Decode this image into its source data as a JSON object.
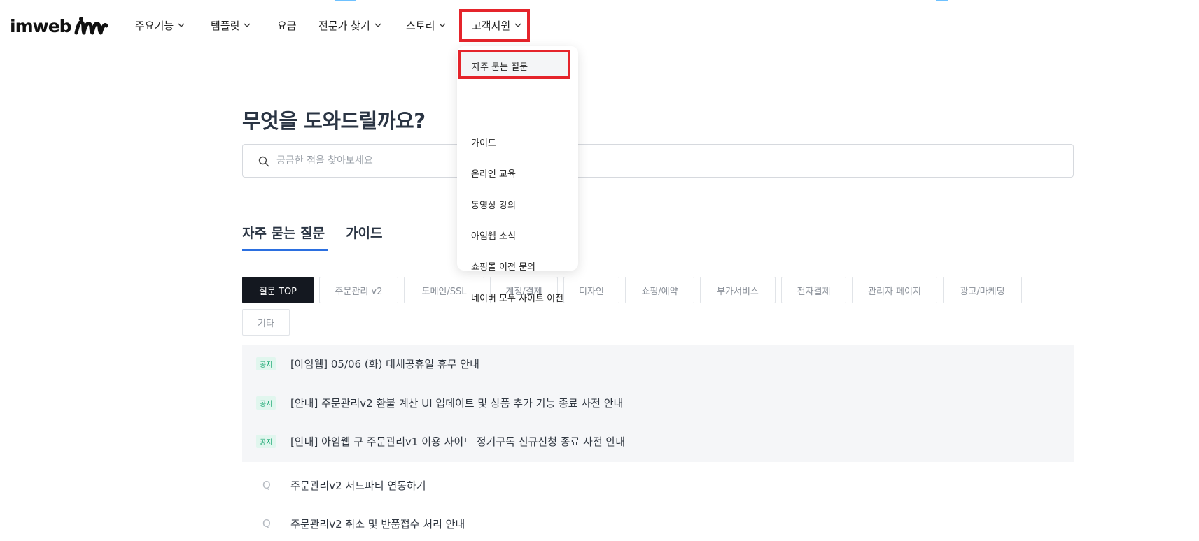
{
  "header": {
    "logo_text": "imweb",
    "nav": [
      {
        "label": "주요기능",
        "has_dropdown": true
      },
      {
        "label": "템플릿",
        "has_dropdown": true
      },
      {
        "label": "요금",
        "has_dropdown": false
      },
      {
        "label": "전문가 찾기",
        "has_dropdown": true
      },
      {
        "label": "스토리",
        "has_dropdown": true
      },
      {
        "label": "고객지원",
        "has_dropdown": true,
        "active": true
      }
    ]
  },
  "dropdown": {
    "items": [
      {
        "label": "자주 묻는 질문",
        "highlighted": true
      },
      {
        "label": "가이드"
      },
      {
        "label": "온라인 교육"
      },
      {
        "label": "동영상 강의"
      },
      {
        "label": "아임웹 소식"
      },
      {
        "label": "쇼핑몰 이전 문의"
      },
      {
        "label": "네이버 모두 사이트 이전"
      }
    ]
  },
  "hero": {
    "title": "무엇을 도와드릴까요?",
    "search_placeholder": "궁금한 점을 찾아보세요"
  },
  "tabs": [
    {
      "label": "자주 묻는 질문",
      "active": true
    },
    {
      "label": "가이드",
      "active": false
    }
  ],
  "categories": [
    {
      "label": "질문 TOP",
      "active": true
    },
    {
      "label": "주문관리 v2"
    },
    {
      "label": "도메인/SSL"
    },
    {
      "label": "계정/결제"
    },
    {
      "label": "디자인"
    },
    {
      "label": "쇼핑/예약"
    },
    {
      "label": "부가서비스"
    },
    {
      "label": "전자결제"
    },
    {
      "label": "관리자 페이지"
    },
    {
      "label": "광고/마케팅"
    },
    {
      "label": "기타"
    }
  ],
  "notices": [
    {
      "badge": "공지",
      "title": "[아임웹] 05/06 (화) 대체공휴일 휴무 안내"
    },
    {
      "badge": "공지",
      "title": "[안내] 주문관리v2 환불 계산 UI 업데이트 및 상품 추가 기능 종료 사전 안내"
    },
    {
      "badge": "공지",
      "title": "[안내] 아임웹 구 주문관리v1 이용 사이트 정기구독 신규신청 종료 사전 안내"
    }
  ],
  "questions": [
    {
      "marker": "Q",
      "title": "주문관리v2 서드파티 연동하기"
    },
    {
      "marker": "Q",
      "title": "주문관리v2 취소 및 반품접수 처리 안내"
    }
  ],
  "colors": {
    "highlight_border": "#e5242b",
    "tab_underline": "#2b6fe0",
    "notice_badge_bg": "#e1f6ee",
    "notice_badge_text": "#15a56f",
    "active_chip_bg": "#141820"
  }
}
